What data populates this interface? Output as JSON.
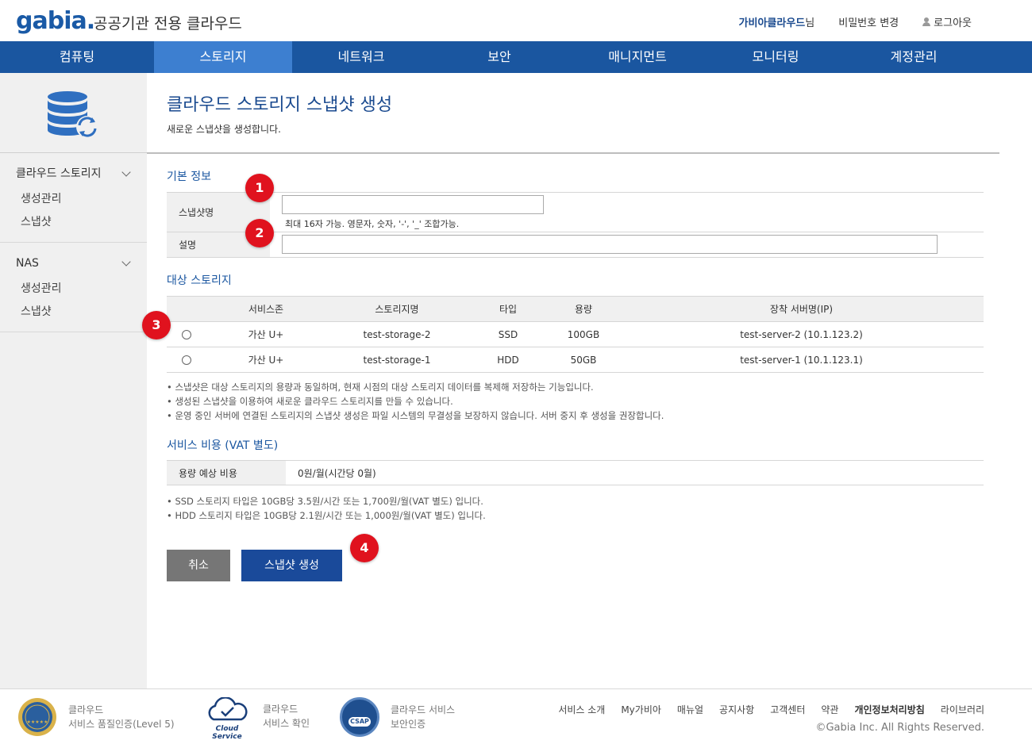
{
  "header": {
    "logo": "gabia.",
    "service_title": "공공기관 전용 클라우드",
    "user_name": "가비아클라우드",
    "user_suffix": "님",
    "change_password": "비밀번호 변경",
    "logout": "로그아웃"
  },
  "nav": {
    "items": [
      "컴퓨팅",
      "스토리지",
      "네트워크",
      "보안",
      "매니지먼트",
      "모니터링",
      "계정관리"
    ],
    "active": "스토리지"
  },
  "sidebar": {
    "groups": [
      {
        "title": "클라우드 스토리지",
        "items": [
          "생성관리",
          "스냅샷"
        ]
      },
      {
        "title": "NAS",
        "items": [
          "생성관리",
          "스냅샷"
        ]
      }
    ]
  },
  "page": {
    "title": "클라우드 스토리지 스냅샷 생성",
    "description": "새로운 스냅샷을 생성합니다."
  },
  "basic_info": {
    "section_title": "기본 정보",
    "snapshot_name_label": "스냅샷명",
    "snapshot_name_value": "",
    "snapshot_name_hint": "최대 16자 가능. 영문자, 숫자, '-', '_' 조합가능.",
    "description_label": "설명",
    "description_value": ""
  },
  "target_storage": {
    "section_title": "대상 스토리지",
    "columns": [
      "서비스존",
      "스토리지명",
      "타입",
      "용량",
      "장착 서버명(IP)"
    ],
    "rows": [
      {
        "zone": "가산 U+",
        "name": "test-storage-2",
        "type": "SSD",
        "size": "100GB",
        "server": "test-server-2 (10.1.123.2)",
        "selected": false
      },
      {
        "zone": "가산 U+",
        "name": "test-storage-1",
        "type": "HDD",
        "size": "50GB",
        "server": "test-server-1 (10.1.123.1)",
        "selected": false
      }
    ],
    "notes": [
      "• 스냅샷은 대상 스토리지의 용량과 동일하며, 현재 시점의 대상 스토리지 데이터를 복제해 저장하는 기능입니다.",
      "• 생성된 스냅샷을 이용하여 새로운 클라우드 스토리지를 만들 수 있습니다.",
      "• 운영 중인 서버에 연결된 스토리지의 스냅샷 생성은 파일 시스템의 무결성을 보장하지 않습니다. 서버 중지 후 생성을 권장합니다."
    ]
  },
  "cost": {
    "section_title": "서비스 비용 (VAT 별도)",
    "label": "용량 예상 비용",
    "value": "0원/월(시간당 0월)",
    "notes": [
      "• SSD 스토리지 타입은 10GB당 3.5원/시간 또는 1,700원/월(VAT 별도) 입니다.",
      "• HDD 스토리지 타입은 10GB당 2.1원/시간 또는 1,000원/월(VAT 별도) 입니다."
    ]
  },
  "buttons": {
    "cancel": "취소",
    "create": "스냅샷 생성"
  },
  "badges": [
    "1",
    "2",
    "3",
    "4"
  ],
  "footer": {
    "certs": [
      {
        "line1": "클라우드",
        "line2": "서비스 품질인증(Level 5)"
      },
      {
        "line1": "클라우드",
        "line2": "서비스 확인"
      },
      {
        "line1": "클라우드 서비스",
        "line2": "보안인증"
      }
    ],
    "cloud_logo_text": "Cloud Service",
    "csap_text": "CSAP",
    "links": [
      "서비스 소개",
      "My가비아",
      "매뉴얼",
      "공지사항",
      "고객센터",
      "약관",
      "개인정보처리방침",
      "라이브러리"
    ],
    "copyright": "©Gabia Inc. All Rights Reserved."
  },
  "colors": {
    "brand": "#1a56a0",
    "nav_active": "#3d7fd0",
    "badge": "#e0121e",
    "create_button": "#1a4a9a",
    "cancel_button": "#767676"
  }
}
